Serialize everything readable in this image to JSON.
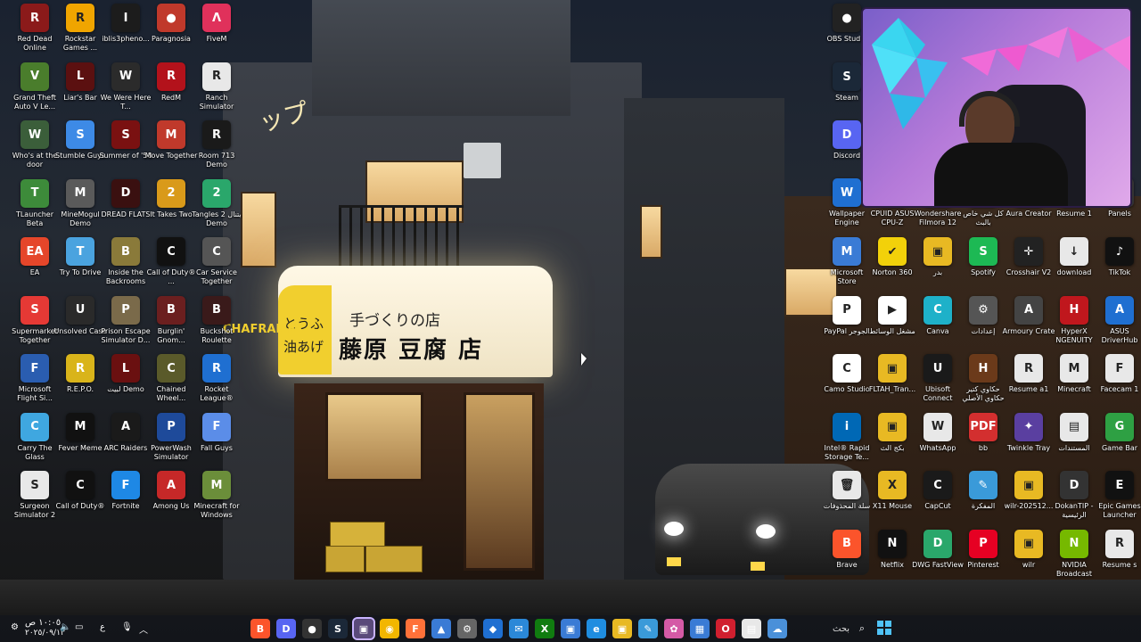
{
  "desktop": {
    "left_icons": [
      {
        "label": "Red Dead Online",
        "color": "#8b1a1a",
        "glyph": "R"
      },
      {
        "label": "Rockstar Games ...",
        "color": "#f0a500",
        "glyph": "R"
      },
      {
        "label": "iblis3pheno...",
        "color": "#1c1c1c",
        "glyph": "I"
      },
      {
        "label": "Paragnosia",
        "color": "#c0392b",
        "glyph": "●"
      },
      {
        "label": "FiveM",
        "color": "#e0315b",
        "glyph": "Λ"
      },
      {
        "label": "Grand Theft Auto V Le...",
        "color": "#4a7d2c",
        "glyph": "V"
      },
      {
        "label": "Liar's Bar",
        "color": "#5b1010",
        "glyph": "L"
      },
      {
        "label": "We Were Here T...",
        "color": "#2b2b2b",
        "glyph": "W"
      },
      {
        "label": "RedM",
        "color": "#b3121b",
        "glyph": "R"
      },
      {
        "label": "Ranch Simulator",
        "color": "#e8e8e8",
        "glyph": "R"
      },
      {
        "label": "Who's at the door",
        "color": "#3b5e3a",
        "glyph": "W"
      },
      {
        "label": "Stumble Guys",
        "color": "#3d8ae6",
        "glyph": "S"
      },
      {
        "label": "Summer of '58",
        "color": "#7a1111",
        "glyph": "S"
      },
      {
        "label": "Move Together",
        "color": "#c0392b",
        "glyph": "M"
      },
      {
        "label": "Room 713 Demo",
        "color": "#1a1a1a",
        "glyph": "R"
      },
      {
        "label": "TLauncher Beta",
        "color": "#3d8b3a",
        "glyph": "T"
      },
      {
        "label": "MineMogul Demo",
        "color": "#5a5a5a",
        "glyph": "M"
      },
      {
        "label": "DREAD FLATS",
        "color": "#3a1010",
        "glyph": "D"
      },
      {
        "label": "It Takes Two",
        "color": "#d99a1a",
        "glyph": "2"
      },
      {
        "label": "Tangles 2 بتنال Demo",
        "color": "#2aa76b",
        "glyph": "2"
      },
      {
        "label": "EA",
        "color": "#e5462a",
        "glyph": "EA"
      },
      {
        "label": "Try To Drive",
        "color": "#4aa3df",
        "glyph": "T"
      },
      {
        "label": "Inside the Backrooms",
        "color": "#8a7a3a",
        "glyph": "B"
      },
      {
        "label": "Call of Duty® ...",
        "color": "#111111",
        "glyph": "C"
      },
      {
        "label": "Car Service Together",
        "color": "#555555",
        "glyph": "C"
      },
      {
        "label": "Supermarket Together",
        "color": "#e53935",
        "glyph": "S"
      },
      {
        "label": "Unsolved Case",
        "color": "#2a2a2a",
        "glyph": "U"
      },
      {
        "label": "Prison Escape Simulator D...",
        "color": "#7a6a4a",
        "glyph": "P"
      },
      {
        "label": "Burglin' Gnom...",
        "color": "#6b1f1f",
        "glyph": "B"
      },
      {
        "label": "Buckshot Roulette",
        "color": "#3a1a1a",
        "glyph": "B"
      },
      {
        "label": "Microsoft Flight Si...",
        "color": "#2a5db0",
        "glyph": "F"
      },
      {
        "label": "R.E.P.O.",
        "color": "#d9b41a",
        "glyph": "R"
      },
      {
        "label": "لبيت Demo",
        "color": "#6a1010",
        "glyph": "L"
      },
      {
        "label": "Chained Wheel...",
        "color": "#5a5a2a",
        "glyph": "C"
      },
      {
        "label": "Rocket League®",
        "color": "#1f6fd1",
        "glyph": "R"
      },
      {
        "label": "Carry The Glass",
        "color": "#3fa7e0",
        "glyph": "C"
      },
      {
        "label": "Fever Meme",
        "color": "#111111",
        "glyph": "M"
      },
      {
        "label": "ARC Raiders",
        "color": "#1a1a1a",
        "glyph": "A"
      },
      {
        "label": "PowerWash Simulator",
        "color": "#1e4a9a",
        "glyph": "P"
      },
      {
        "label": "Fall Guys",
        "color": "#5b8de8",
        "glyph": "F"
      },
      {
        "label": "Surgeon Simulator 2",
        "color": "#e8e8e8",
        "glyph": "S"
      },
      {
        "label": "Call of Duty®",
        "color": "#111111",
        "glyph": "C"
      },
      {
        "label": "Fortnite",
        "color": "#1e88e5",
        "glyph": "F"
      },
      {
        "label": "Among Us",
        "color": "#c62828",
        "glyph": "A"
      },
      {
        "label": "Minecraft for Windows",
        "color": "#6b8e3a",
        "glyph": "M"
      }
    ],
    "right_icons": [
      {
        "label": "OBS Studio",
        "color": "#222222",
        "glyph": "●"
      },
      {
        "label": "Steam",
        "color": "#1b2838",
        "glyph": "S"
      },
      {
        "label": "Discord",
        "color": "#5865f2",
        "glyph": "D"
      },
      {
        "label": "Wallpaper Engine",
        "color": "#1f6fd1",
        "glyph": "W"
      },
      {
        "label": "CPUID ASUS CPU-Z",
        "color": "#1a1a1a",
        "glyph": "Z"
      },
      {
        "label": "Wondershare Filmora 12",
        "color": "#16a2a0",
        "glyph": "F"
      },
      {
        "label": "كل شي خاص بالبث",
        "color": "#d4a21a",
        "glyph": "▣"
      },
      {
        "label": "Aura Creator",
        "color": "#333333",
        "glyph": "A"
      },
      {
        "label": "Resume 1",
        "color": "#e8e8e8",
        "glyph": "R"
      },
      {
        "label": "Panels",
        "color": "#333333",
        "glyph": "P"
      },
      {
        "label": "Microsoft Store",
        "color": "#3a7bd5",
        "glyph": "M"
      },
      {
        "label": "Norton 360",
        "color": "#f2d10a",
        "glyph": "✔"
      },
      {
        "label": "بدر",
        "color": "#e8b923",
        "glyph": "▣"
      },
      {
        "label": "Spotify",
        "color": "#1db954",
        "glyph": "S"
      },
      {
        "label": "Crosshair V2",
        "color": "#222222",
        "glyph": "✛"
      },
      {
        "label": "download",
        "color": "#e8e8e8",
        "glyph": "↓"
      },
      {
        "label": "TikTok",
        "color": "#111111",
        "glyph": "♪"
      },
      {
        "label": "PayPal الجوجر",
        "color": "#ffffff",
        "glyph": "P"
      },
      {
        "label": "مشغل الوسائط",
        "color": "#ffffff",
        "glyph": "▶"
      },
      {
        "label": "Canva",
        "color": "#1eb1c9",
        "glyph": "C"
      },
      {
        "label": "إعدادات",
        "color": "#555555",
        "glyph": "⚙"
      },
      {
        "label": "Armoury Crate",
        "color": "#444444",
        "glyph": "A"
      },
      {
        "label": "HyperX NGENUITY",
        "color": "#c0171d",
        "glyph": "H"
      },
      {
        "label": "ASUS DriverHub",
        "color": "#1f6fd1",
        "glyph": "A"
      },
      {
        "label": "Camo Studio",
        "color": "#ffffff",
        "glyph": "C"
      },
      {
        "label": "FLTAH_Tran...",
        "color": "#e8b923",
        "glyph": "▣"
      },
      {
        "label": "Ubisoft Connect",
        "color": "#1a1a1a",
        "glyph": "U"
      },
      {
        "label": "حكاوي كتير حكاوي الأصلي",
        "color": "#6b3a1a",
        "glyph": "H"
      },
      {
        "label": "Resume a1",
        "color": "#e8e8e8",
        "glyph": "R"
      },
      {
        "label": "Minecraft",
        "color": "#e8e8e8",
        "glyph": "M"
      },
      {
        "label": "Facecam 1",
        "color": "#e8e8e8",
        "glyph": "F"
      },
      {
        "label": "Intel® Rapid Storage Te...",
        "color": "#0068b5",
        "glyph": "i"
      },
      {
        "label": "بكج الث",
        "color": "#e8b923",
        "glyph": "▣"
      },
      {
        "label": "WhatsApp",
        "color": "#e8e8e8",
        "glyph": "W"
      },
      {
        "label": "bb",
        "color": "#d32f2f",
        "glyph": "PDF"
      },
      {
        "label": "Twinkle Tray",
        "color": "#5a3fa0",
        "glyph": "✦"
      },
      {
        "label": "المستندات",
        "color": "#e8e8e8",
        "glyph": "▤"
      },
      {
        "label": "Game Bar",
        "color": "#2ea043",
        "glyph": "G"
      },
      {
        "label": "سلة المحذوفات",
        "color": "#e8e8e8",
        "glyph": "🗑"
      },
      {
        "label": "X11 Mouse",
        "color": "#e8b923",
        "glyph": "X"
      },
      {
        "label": "CapCut",
        "color": "#1a1a1a",
        "glyph": "C"
      },
      {
        "label": "المفكرة",
        "color": "#3a9ad9",
        "glyph": "✎"
      },
      {
        "label": "wilr-202512...",
        "color": "#e8b923",
        "glyph": "▣"
      },
      {
        "label": "DokanTIP - الرئيسية",
        "color": "#333333",
        "glyph": "D"
      },
      {
        "label": "Epic Games Launcher",
        "color": "#111111",
        "glyph": "E"
      },
      {
        "label": "Brave",
        "color": "#fb542b",
        "glyph": "B"
      },
      {
        "label": "Netflix",
        "color": "#111111",
        "glyph": "N"
      },
      {
        "label": "DWG FastView",
        "color": "#2aa76b",
        "glyph": "D"
      },
      {
        "label": "Pinterest",
        "color": "#e60023",
        "glyph": "P"
      },
      {
        "label": "wilr",
        "color": "#e8b923",
        "glyph": "▣"
      },
      {
        "label": "NVIDIA Broadcast",
        "color": "#76b900",
        "glyph": "N"
      },
      {
        "label": "Resume s",
        "color": "#e8e8e8",
        "glyph": "R"
      }
    ],
    "sign": {
      "sign_top_left": "とうふ",
      "sign_bottom_left": "油あげ",
      "sign_top": "手づくりの店",
      "sign_main": "藤原 豆腐 店",
      "katakana": "ップ",
      "shop_label": "CHAFRAME"
    }
  },
  "taskbar": {
    "time": "١٠:٠٥ ص",
    "date": "٢٠٢٥/٠٩/١٣",
    "search_placeholder": "بحث",
    "lang": "ع",
    "apps": [
      {
        "name": "brave",
        "color": "#fb542b",
        "glyph": "B"
      },
      {
        "name": "discord",
        "color": "#5865f2",
        "glyph": "D"
      },
      {
        "name": "obs",
        "color": "#333333",
        "glyph": "●"
      },
      {
        "name": "steam",
        "color": "#1b2838",
        "glyph": "S"
      },
      {
        "name": "terminal",
        "color": "#5a4a7a",
        "glyph": "▣"
      },
      {
        "name": "chrome",
        "color": "#f2b600",
        "glyph": "◉"
      },
      {
        "name": "firefox",
        "color": "#ff7139",
        "glyph": "F"
      },
      {
        "name": "photos",
        "color": "#3a7bd5",
        "glyph": "▲"
      },
      {
        "name": "settings",
        "color": "#666666",
        "glyph": "⚙"
      },
      {
        "name": "vscode",
        "color": "#1f6fd1",
        "glyph": "◆"
      },
      {
        "name": "mail",
        "color": "#2b88d8",
        "glyph": "✉"
      },
      {
        "name": "xbox",
        "color": "#107c10",
        "glyph": "X"
      },
      {
        "name": "store",
        "color": "#3a7bd5",
        "glyph": "▣"
      },
      {
        "name": "edge",
        "color": "#1f8de0",
        "glyph": "e"
      },
      {
        "name": "explorer",
        "color": "#e8b923",
        "glyph": "▣"
      },
      {
        "name": "notepad",
        "color": "#3a9ad9",
        "glyph": "✎"
      },
      {
        "name": "paint",
        "color": "#d45aa6",
        "glyph": "✿"
      },
      {
        "name": "calendar",
        "color": "#3a7bd5",
        "glyph": "▦"
      },
      {
        "name": "opera",
        "color": "#d01f2f",
        "glyph": "O"
      },
      {
        "name": "files",
        "color": "#e8e8e8",
        "glyph": "▤"
      },
      {
        "name": "widgets",
        "color": "#4a90d9",
        "glyph": "☁"
      }
    ]
  },
  "overlay": {
    "webcam_label": "webcam"
  }
}
